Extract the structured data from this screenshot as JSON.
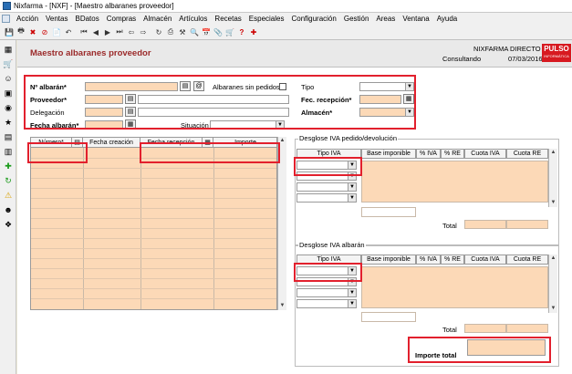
{
  "window": {
    "title": "Nixfarma - [NXF] - [Maestro albaranes proveedor]"
  },
  "menu": [
    "Acción",
    "Ventas",
    "BDatos",
    "Compras",
    "Almacén",
    "Artículos",
    "Recetas",
    "Especiales",
    "Configuración",
    "Gestión",
    "Areas",
    "Ventana",
    "Ayuda"
  ],
  "toolbar_icons": [
    "save-icon",
    "print-icon",
    "close-icon",
    "cancel-icon",
    "document-icon",
    "undo-icon",
    "first-icon",
    "prev-icon",
    "next-icon",
    "last-icon",
    "back-icon",
    "refresh-icon",
    "print-icon",
    "tools-icon",
    "search-icon",
    "calendar-icon",
    "attach-icon",
    "cart-icon",
    "help-icon",
    "alert-icon"
  ],
  "left_icons": [
    "calculator-icon",
    "cart-icon",
    "person-icon",
    "box-icon",
    "pills-icon",
    "star-icon",
    "chart-icon",
    "box-icon",
    "plus-icon",
    "refresh-icon",
    "warning-icon",
    "users-icon",
    "puzzle-icon"
  ],
  "header": {
    "form_title": "Maestro albaranes proveedor",
    "company": "NIXFARMA DIRECTO",
    "status": "Consultando",
    "date": "07/03/2016",
    "logo_text": "PULSO",
    "logo_sub": "INFORMÁTICA"
  },
  "form": {
    "albaran_label": "Nº albarán*",
    "albaran_value": "",
    "at_button": "@",
    "sin_pedidos_label": "Albaranes sin pedidos",
    "tipo_label": "Tipo",
    "proveedor_label": "Proveedor*",
    "fec_recepcion_label": "Fec. recepción*",
    "delegacion_label": "Delegación",
    "almacen_label": "Almacén*",
    "fecha_albaran_label": "Fecha albarán*",
    "situacion_label": "Situación"
  },
  "lines_table": {
    "columns": [
      "Número*",
      "Fecha creación",
      "Fecha recepción",
      "Importe"
    ]
  },
  "iva_pedido": {
    "title": "Desglose IVA pedido/devolución",
    "columns": [
      "Tipo IVA",
      "Base imponible",
      "% IVA",
      "% RE",
      "Cuota IVA",
      "Cuota RE"
    ],
    "total_label": "Total"
  },
  "iva_albaran": {
    "title": "Desglose IVA albarán",
    "columns": [
      "Tipo IVA",
      "Base imponible",
      "% IVA",
      "% RE",
      "Cuota IVA",
      "Cuota RE"
    ],
    "total_label": "Total"
  },
  "importe_total": {
    "label": "Importe total",
    "value": ""
  },
  "colors": {
    "accent_title": "#9b2a2a",
    "field_fill": "#fcd9b7",
    "highlight": "#e2202d"
  }
}
